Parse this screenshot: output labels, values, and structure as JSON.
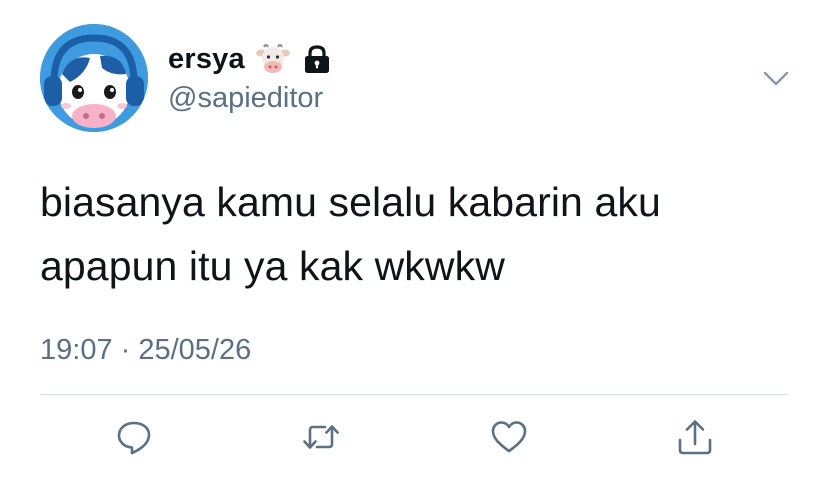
{
  "user": {
    "display_name": "ersya",
    "handle": "@sapieditor",
    "name_emoji": "cow-face-emoji",
    "protected_icon": "lock-icon"
  },
  "tweet": {
    "text": "biasanya kamu selalu kabarin aku\napapun itu ya kak wkwkw",
    "timestamp": "19:07 · 25/05/26"
  },
  "actions": [
    {
      "name": "reply",
      "icon": "reply-icon"
    },
    {
      "name": "retweet",
      "icon": "retweet-icon"
    },
    {
      "name": "like",
      "icon": "heart-icon"
    },
    {
      "name": "share",
      "icon": "share-icon"
    }
  ],
  "colors": {
    "text_primary": "#0f1419",
    "text_secondary": "#5b7083",
    "icon_gray": "#5b7083",
    "divider": "#d7dee3",
    "avatar_bg": "#3f9be0"
  }
}
